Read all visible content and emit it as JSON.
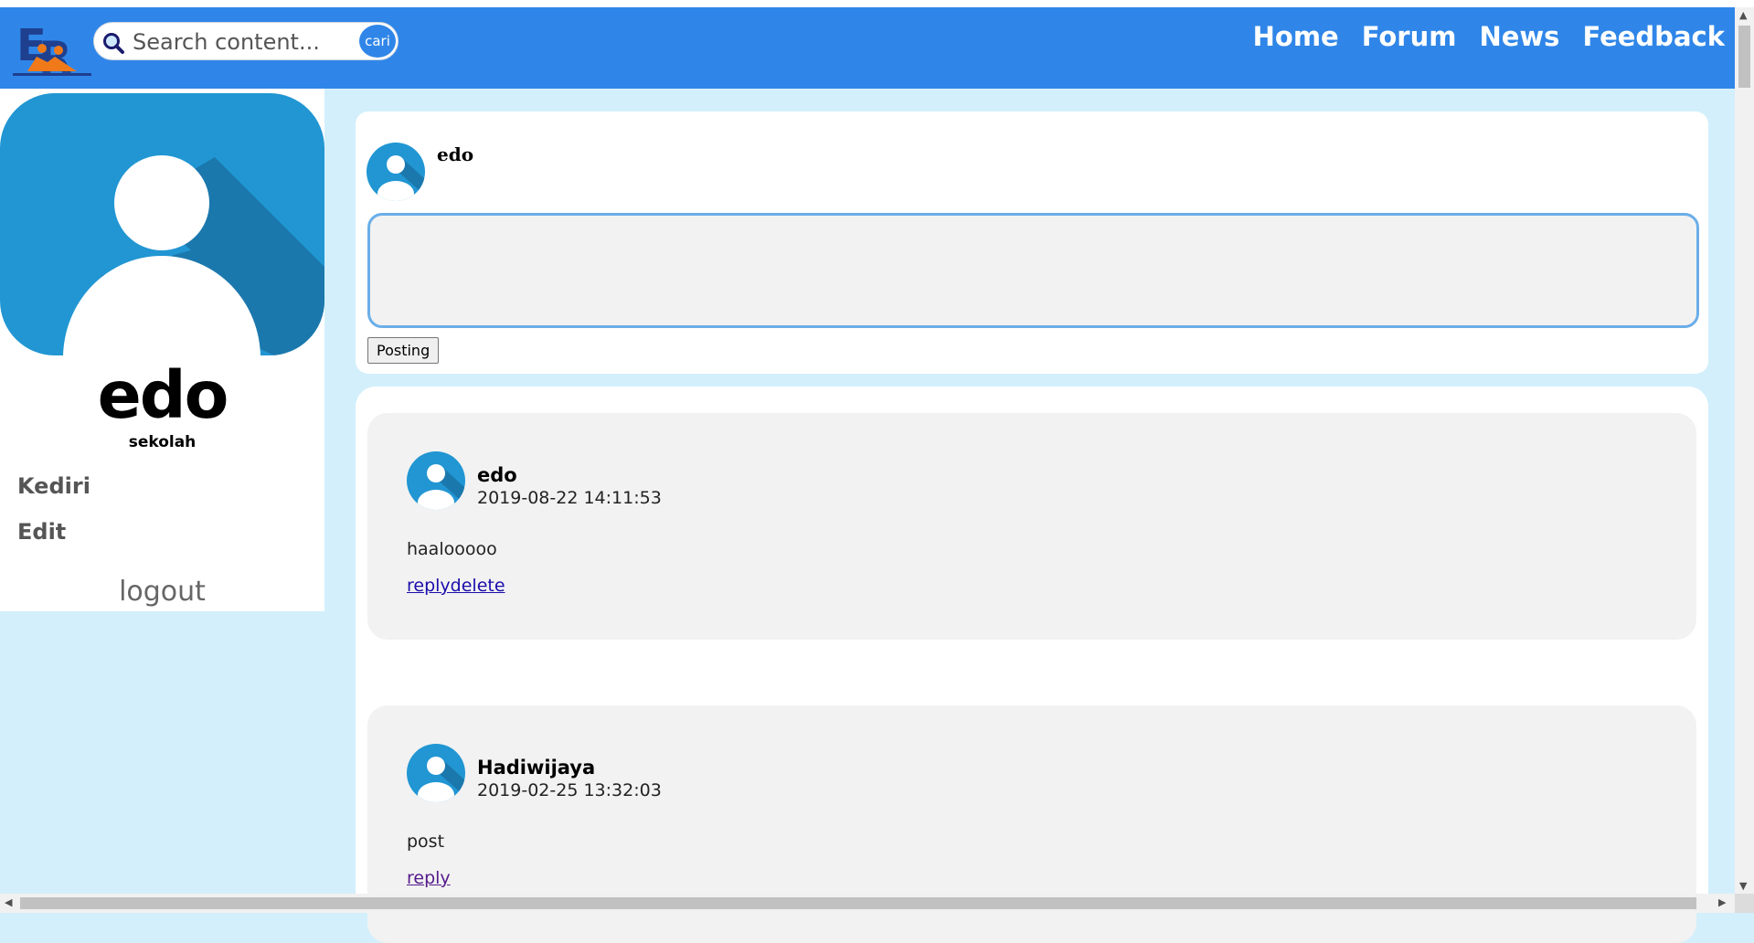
{
  "navbar": {
    "logo_text": "ER",
    "search": {
      "placeholder": "Search content...",
      "button_label": "cari"
    },
    "links": [
      "Home",
      "Forum",
      "News",
      "Feedback"
    ]
  },
  "sidebar": {
    "name": "edo",
    "school": "sekolah",
    "city": "Kediri",
    "edit_label": "Edit",
    "logout_label": "logout"
  },
  "composer": {
    "username": "edo",
    "text": "",
    "submit_label": "Posting"
  },
  "posts": [
    {
      "author": "edo",
      "timestamp": "2019-08-22 14:11:53",
      "body": "haalooooo",
      "reply_label": "reply",
      "delete_label": "delete"
    },
    {
      "author": "Hadiwijaya",
      "timestamp": "2019-02-25 13:32:03",
      "body": "post",
      "reply_label": "reply"
    }
  ],
  "colors": {
    "navbar": "#2f86e8",
    "page_background": "#d3effb",
    "avatar_blue": "#2196d3",
    "post_background": "#f2f2f2",
    "link": "#1a0dab"
  },
  "icons": {
    "logo": "er-logo-icon",
    "search": "magnifier-icon",
    "avatar": "user-avatar-icon"
  }
}
